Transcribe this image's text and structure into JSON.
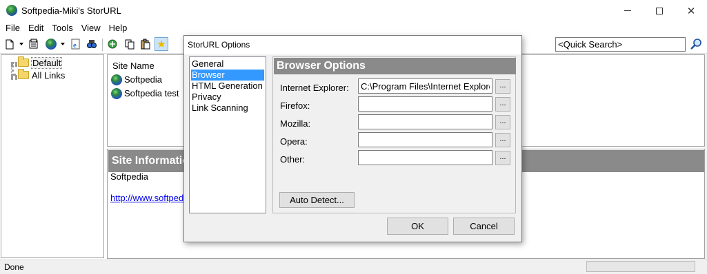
{
  "window": {
    "title": "Softpedia-Miki's StorURL",
    "icon": "globe-icon"
  },
  "menu": [
    "File",
    "Edit",
    "Tools",
    "View",
    "Help"
  ],
  "toolbar": {
    "quick_search_value": "<Quick Search>"
  },
  "tree": {
    "items": [
      {
        "label": "Default",
        "selected": true,
        "icon": "folder-icon"
      },
      {
        "label": "All Links",
        "selected": false,
        "icon": "folder-icon"
      }
    ]
  },
  "site_list": {
    "column_header": "Site Name",
    "rows": [
      {
        "label": "Softpedia",
        "icon": "globe-icon"
      },
      {
        "label": "Softpedia test",
        "icon": "globe-icon"
      }
    ]
  },
  "site_info": {
    "header": "Site Information",
    "name": "Softpedia",
    "url": "http://www.softpedia.com"
  },
  "status": {
    "text": "Done"
  },
  "dialog": {
    "title": "StorURL Options",
    "categories": [
      "General",
      "Browser",
      "HTML Generation",
      "Privacy",
      "Link Scanning"
    ],
    "selected_category": "Browser",
    "panel_title": "Browser Options",
    "fields": [
      {
        "label": "Internet Explorer:",
        "value": "C:\\Program Files\\Internet Explorer",
        "browse": "..."
      },
      {
        "label": "Firefox:",
        "value": "",
        "browse": "..."
      },
      {
        "label": "Mozilla:",
        "value": "",
        "browse": "..."
      },
      {
        "label": "Opera:",
        "value": "",
        "browse": "..."
      },
      {
        "label": "Other:",
        "value": "",
        "browse": "..."
      }
    ],
    "auto_detect_label": "Auto Detect...",
    "ok_label": "OK",
    "cancel_label": "Cancel"
  },
  "colors": {
    "header_gray": "#8a8a8a",
    "selection_blue": "#3399ff",
    "link_blue": "#0000ee"
  }
}
